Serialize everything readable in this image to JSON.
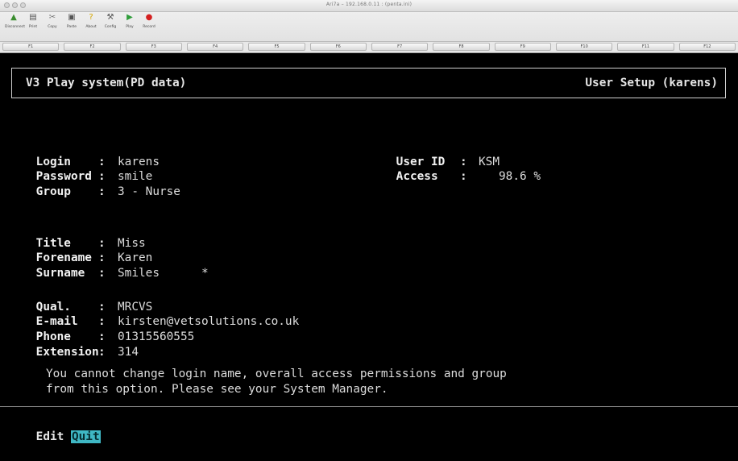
{
  "window": {
    "title": "Ari7a – 192.168.0.11 : (penta.ini)"
  },
  "toolbar": {
    "buttons": [
      {
        "label": "Disconnect",
        "icon": "disconnect-icon",
        "glyph": "▲",
        "color": "#3a8d2f"
      },
      {
        "label": "Print",
        "icon": "print-icon",
        "glyph": "▤",
        "color": "#555555"
      },
      {
        "label": "Copy",
        "icon": "copy-icon",
        "glyph": "✂",
        "color": "#777777"
      },
      {
        "label": "Paste",
        "icon": "paste-icon",
        "glyph": "▣",
        "color": "#555555"
      },
      {
        "label": "About",
        "icon": "about-icon",
        "glyph": "?",
        "color": "#d4a600"
      },
      {
        "label": "Config",
        "icon": "config-icon",
        "glyph": "⚒",
        "color": "#555555"
      },
      {
        "label": "Play",
        "icon": "play-icon",
        "glyph": "▶",
        "color": "#2f9d3a"
      },
      {
        "label": "Record",
        "icon": "record-icon",
        "glyph": "●",
        "color": "#d42020"
      }
    ]
  },
  "function_keys": [
    "F1",
    "F2",
    "F3",
    "F4",
    "F5",
    "F6",
    "F7",
    "F8",
    "F9",
    "F10",
    "F11",
    "F12"
  ],
  "header": {
    "system_title": "V3 Play system(PD data)",
    "screen_title": "User Setup (karens)"
  },
  "fields": {
    "login": {
      "label": "Login",
      "value": "karens"
    },
    "password": {
      "label": "Password",
      "value": "smile"
    },
    "group": {
      "label": "Group",
      "value": "3 - Nurse"
    },
    "user_id": {
      "label": "User ID",
      "value": "KSM"
    },
    "access": {
      "label": "Access",
      "value": "98.6 %"
    },
    "title": {
      "label": "Title",
      "value": "Miss"
    },
    "forename": {
      "label": "Forename",
      "value": "Karen"
    },
    "surname": {
      "label": "Surname",
      "value": "Smiles",
      "marker": "*"
    },
    "qual": {
      "label": "Qual.",
      "value": "MRCVS"
    },
    "email": {
      "label": "E-mail",
      "value": "kirsten@vetsolutions.co.uk"
    },
    "phone": {
      "label": "Phone",
      "value": "01315560555"
    },
    "extension": {
      "label": "Extension",
      "value": "314"
    }
  },
  "separator": ":",
  "message": {
    "line1": "You cannot change login name, overall access permissions and group",
    "line2": "from this option. Please see your System Manager."
  },
  "menu": {
    "items": [
      "Edit",
      "Quit"
    ],
    "selected": "Quit"
  }
}
